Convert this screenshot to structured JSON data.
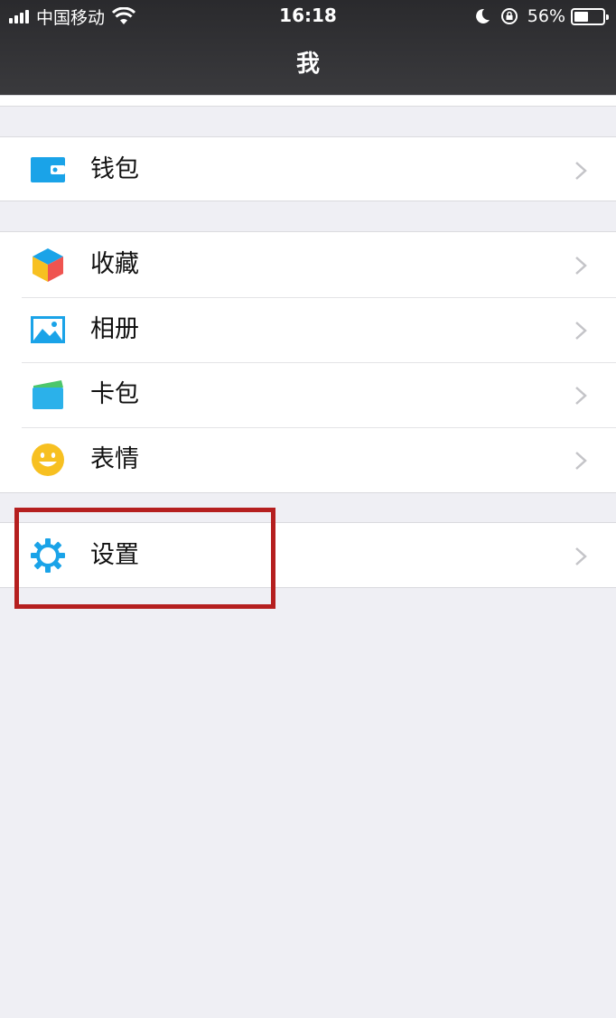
{
  "status_bar": {
    "carrier": "中国移动",
    "time": "16:18",
    "battery_percent": "56%",
    "battery_level": 0.56,
    "icons": [
      "signal-icon",
      "wifi-icon",
      "moon-icon",
      "rotation-lock-icon",
      "battery-icon"
    ]
  },
  "nav": {
    "title": "我"
  },
  "groups": [
    {
      "items": [
        {
          "label": "钱包",
          "icon": "wallet-icon"
        }
      ]
    },
    {
      "items": [
        {
          "label": "收藏",
          "icon": "favorites-cube-icon"
        },
        {
          "label": "相册",
          "icon": "album-icon"
        },
        {
          "label": "卡包",
          "icon": "card-pack-icon"
        },
        {
          "label": "表情",
          "icon": "smiley-icon"
        }
      ]
    },
    {
      "items": [
        {
          "label": "设置",
          "icon": "settings-gear-icon",
          "highlighted": true
        }
      ]
    }
  ],
  "colors": {
    "header_bg": "#333336",
    "page_bg": "#efeff4",
    "highlight_box": "#b51f1f",
    "accent_blue": "#1aa3e8"
  }
}
